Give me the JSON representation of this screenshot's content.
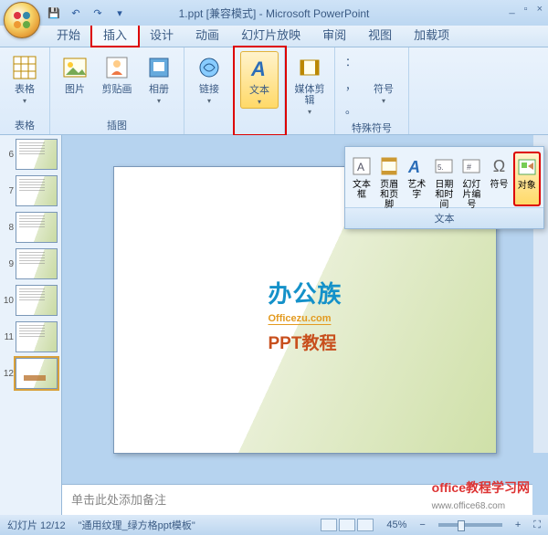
{
  "window": {
    "title": "1.ppt [兼容模式] - Microsoft PowerPoint",
    "min": "_",
    "restore": "▫",
    "close": "×"
  },
  "qat": {
    "save": "💾",
    "undo": "↶",
    "redo": "↷",
    "more": "▾"
  },
  "tabs": {
    "home": "开始",
    "insert": "插入",
    "design": "设计",
    "anim": "动画",
    "slideshow": "幻灯片放映",
    "review": "审阅",
    "view": "视图",
    "addin": "加载项"
  },
  "ribbon": {
    "table": {
      "label": "表格",
      "group": "表格"
    },
    "illus": {
      "pic": "图片",
      "clip": "剪贴画",
      "album": "相册",
      "group": "插图"
    },
    "links": {
      "link": "链接"
    },
    "text": {
      "btn": "文本"
    },
    "media": {
      "clip": "媒体剪辑"
    },
    "symbols": {
      "sym": "符号",
      "group": "特殊符号"
    }
  },
  "dropdown": {
    "textbox": "文本框",
    "header": "页眉和页脚",
    "wordart": "艺术字",
    "datetime": "日期和时间",
    "slidenum": "幻灯片编号",
    "symbol": "符号",
    "object": "对象",
    "group": "文本"
  },
  "thumbs": [
    "6",
    "7",
    "8",
    "9",
    "10",
    "11",
    "12"
  ],
  "slide": {
    "brand": "办公族",
    "url": "Officezu.com",
    "course": "PPT教程"
  },
  "notes": {
    "placeholder": "单击此处添加备注"
  },
  "status": {
    "slide": "幻灯片 12/12",
    "theme": "\"通用纹理_绿方格ppt模板\"",
    "lang": "",
    "zoom": "45%"
  },
  "watermark": {
    "text": "office教程学习网",
    "url": "www.office68.com"
  }
}
